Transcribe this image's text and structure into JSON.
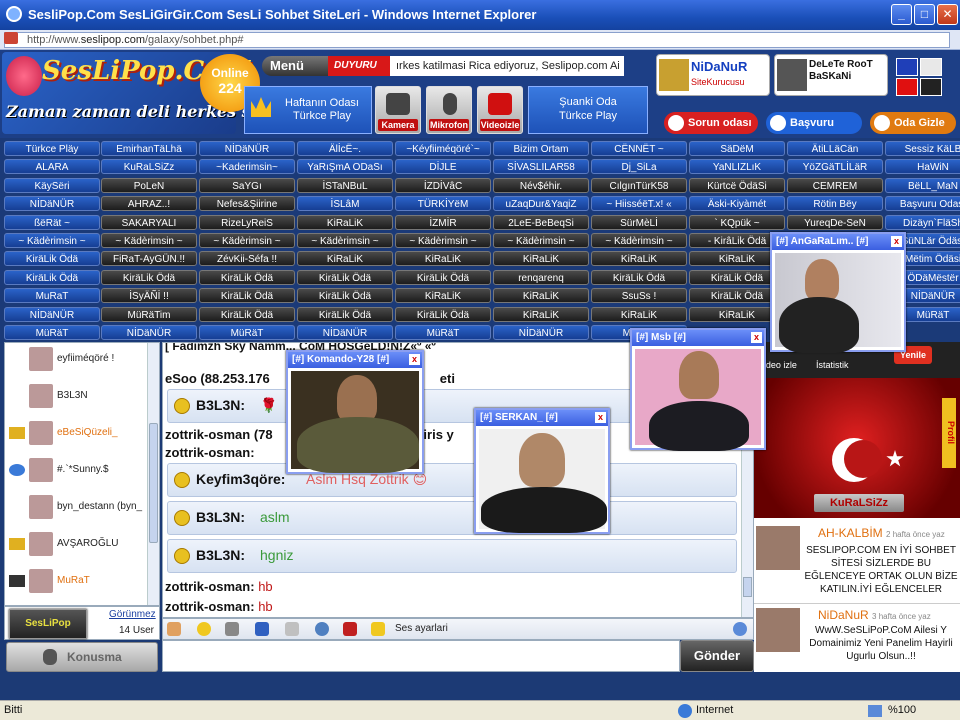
{
  "window": {
    "title": "SesliPop.Com SesLiGirGir.Com SesLi Sohbet SiteLeri - Windows Internet Explorer",
    "minimize": "_",
    "maximize": "□",
    "close": "✕"
  },
  "address": {
    "prefix": "http://www.",
    "host": "seslipop.com",
    "path": "/galaxy/sohbet.php#"
  },
  "header": {
    "logo_title": "SesLiPop.CoM",
    "logo_slogan": "Zaman zaman deli herkes sohbet",
    "online_label": "Online",
    "online_count": "224",
    "menu_label": "Menü",
    "duyuru_label": "DUYURU",
    "marquee": "ırkes katilmasi Rica ediyoruz, Seslipop.com Ai",
    "weekly_room": "Haftanın Odası Türkce Play",
    "icons": [
      {
        "label": "Kamera",
        "icon": "camera-icon"
      },
      {
        "label": "Mikrofon",
        "icon": "microphone-icon"
      },
      {
        "label": "Videoizle",
        "icon": "youtube-icon"
      }
    ],
    "current_room_line1": "Şuanki Oda",
    "current_room_line2": "Türkce Play",
    "admins": [
      {
        "name": "NiDaNuR",
        "role": "SiteKurucusu"
      },
      {
        "name": "DeLeTe RooT BaSKaNi",
        "role": ""
      }
    ],
    "pills": [
      {
        "label": "Sorun odası",
        "color": "#d82020"
      },
      {
        "label": "Başvuru odası",
        "color": "#1f62d8"
      },
      {
        "label": "Oda Gizle",
        "color": "#e07a10"
      }
    ]
  },
  "rooms": [
    [
      "Türkce Pläy",
      "EmirhanTäLhä",
      "NİDäNÜR",
      "ÄlİcË~.",
      "~Kéyfiiméqöré`~",
      "Bizim Ortam",
      "CËNNËT ~",
      "SäDëM",
      "ÄtiLLäCän",
      "Sessiz KäLB"
    ],
    [
      "ALARA",
      "KuRaLSiZz",
      "~Kaderimsin~",
      "YaRıŞmA ODaSı",
      "DİJLE",
      "SİVASLILAR58",
      "Dj_SiLa",
      "YaNLIZLıK",
      "YöZGäTLİLäR",
      "HaWiN"
    ],
    [
      "KäySëri",
      "PoLeN",
      "SaYGı",
      "İSTaNBuL",
      "İZDİVâC",
      "Név$éhir.",
      "CılgınTürK58",
      "Kürtcë ÖdäSi",
      "CEMREM",
      "BëLL_MaN"
    ],
    [
      "NİDäNÜR",
      "AHRAZ..!",
      "Nefes&Şiirine",
      "İSLâM",
      "TÜRKİYëM",
      "uZaqDur&YaqiZ",
      "~ HiisséëT.x! «",
      "Äski-Kiyàmét",
      "Rötin Bëy",
      "Başvuru Odası"
    ],
    [
      "ßëRät ~",
      "SAKARYALI",
      "RizeLyReiS",
      "KiRaLiK",
      "İZMİR",
      "2LeE-BeBeqSi",
      "SürMèLİ",
      "` KQpük ~",
      "YureqDe-SeN",
      "Dizäyn`FläSh"
    ],
    [
      "~ Kädèrimsin ~",
      "~ Kädèrimsin ~",
      "~ Kädèrimsin ~",
      "~ Kädèrimsin ~",
      "~ Kädèrimsin ~",
      "~ Kädèrimsin ~",
      "~ Kädèrimsin ~",
      "- KirâLik Ödä",
      "",
      "SüNLär Ödäsi"
    ],
    [
      "KiräLik Ödä",
      "FiRaT-AyGÜN.!!",
      "ZévKii-Séfa !!",
      "KiRaLiK",
      "KiRaLiK",
      "KiRaLiK",
      "KiRaLiK",
      "KiRaLiK",
      "",
      "Mëtim Ödäsi"
    ],
    [
      "KiräLik Ödä",
      "KiräLik Ödä",
      "KiräLik Ödä",
      "KiräLik Ödä",
      "KiräLik Ödä",
      "renqarenq",
      "KiräLik Ödä",
      "KiräLik Ödä",
      "",
      "ÖDäMëstër"
    ],
    [
      "MuRaT",
      "İSyÄÑİ !!",
      "KiräLik Ödä",
      "KiräLik Ödä",
      "KiRaLiK",
      "KiRaLiK",
      "SsuSs !",
      "KiräLik Ödä",
      "",
      "NİDäNÜR"
    ],
    [
      "NİDäNÜR",
      "MüRäTim",
      "KiräLik Ödä",
      "KiräLik Ödä",
      "KiräLik Ödä",
      "KiRaLiK",
      "KiRaLiK",
      "KiRaLiK",
      "",
      "MüRäT"
    ],
    [
      "MüRäT",
      "NİDäNÜR",
      "MüRäT",
      "NİDäNÜR",
      "MüRäT",
      "NİDäNÜR",
      "MüRäT",
      "",
      "",
      ""
    ]
  ],
  "users": [
    {
      "name": "eyfiiméqöré !",
      "icon": "none"
    },
    {
      "name": "B3L3N",
      "icon": "none"
    },
    {
      "name": "eBeSiQüzeli_",
      "icon": "key-icon"
    },
    {
      "name": "#.`*Sunny.$",
      "icon": "help-icon"
    },
    {
      "name": "byn_destann (byn_",
      "icon": "none"
    },
    {
      "name": "AVŞAROĞLU",
      "icon": "key-icon"
    },
    {
      "name": "MuRaT",
      "icon": "glasses-icon"
    }
  ],
  "userfoot": {
    "cam_label": "SesLiPop",
    "gorunmez": "Görünmez",
    "count": "14 User"
  },
  "konusma": "Konusma",
  "chat": {
    "top_line": "[ Fadimzh Sky Namm...                                        CoM  HOŞGéLD!N!Z«º «º",
    "l1": "eSoo (88.253.176",
    "l1b": "eti",
    "b1_user": "B3L3N:",
    "b1_msg": "🌹",
    "l2_user": "zottrik-osman (78",
    "l2_msg": "a giris y",
    "l3_user": "zottrik-osman:",
    "b2_user": "Keyfim3qöre:",
    "b2_msg": "Aslm Hsq Zottrik 😊",
    "b3_user": "B3L3N:",
    "b3_msg": "aslm",
    "b4_user": "B3L3N:",
    "b4_msg": "hgniz",
    "l4_user": "zottrik-osman:",
    "l4_msg": "hb",
    "l5_user": "zottrik-osman:",
    "l5_msg": "hb"
  },
  "toolbar": {
    "ses": "Ses ayarlari"
  },
  "send": "Gönder",
  "cams": [
    {
      "title": "[#] AnGaRaLım.. [#]"
    },
    {
      "title": "[#] Msb [#]"
    },
    {
      "title": "[#] Komando-Y28 [#]"
    },
    {
      "title": "[#] SERKAN_ [#]"
    }
  ],
  "right": {
    "kural": "KuRaLSiZz",
    "side_text": "Profil",
    "tabs": [
      "Video izle",
      "İstatistik",
      "Yenile"
    ],
    "news": [
      {
        "author": "AH-KALBİM",
        "when": "2 hafta önce yaz",
        "text": "SESLIPOP.COM EN İYİ SOHBET SİTESİ SİZLERDE BU EĞLENCEYE ORTAK OLUN BİZE KATILIN.İYİ EĞLENCELER"
      },
      {
        "author": "NiDaNuR",
        "when": "3 hafta önce yaz",
        "text": "WwW.SeSLiPoP.CoM Ailesi Y Domainimiz Yeni Panelim Hayirli Ugurlu Olsun..!!"
      }
    ]
  },
  "status": {
    "left": "Bitti",
    "zone": "Internet",
    "zoom": "%100"
  }
}
